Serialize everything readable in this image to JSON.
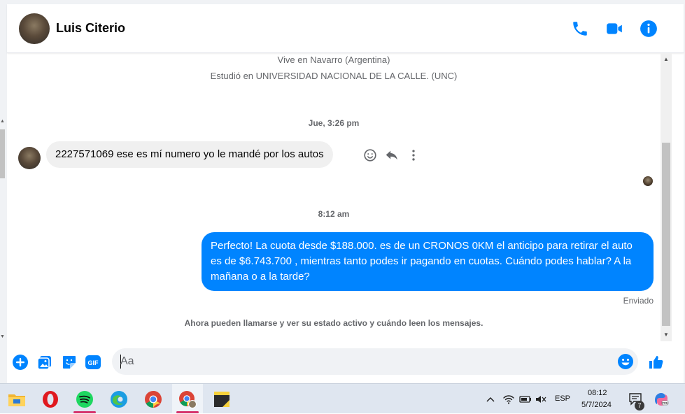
{
  "header": {
    "contact_name": "Luis Citerio",
    "icons": [
      "phone-icon",
      "video-camera-icon",
      "info-icon"
    ]
  },
  "profile": {
    "lives_in": "Vive en Navarro (Argentina)",
    "studied_at": "Estudió en UNIVERSIDAD NACIONAL DE LA CALLE. (UNC)"
  },
  "conversation": {
    "time_separator_1": "Jue, 3:26 pm",
    "incoming_message": "2227571069 ese es mí numero yo le mandé por los autos",
    "time_separator_2": "8:12 am",
    "outgoing_message": "Perfecto! La cuota desde $188.000. es de un CRONOS 0KM el anticipo para retirar el auto es de $6.743.700 , mientras tanto podes ir pagando en cuotas. Cuándo podes hablar? A la mañana o a la tarde?",
    "sent_status": "Enviado",
    "notice": "Ahora pueden llamarse y ver su estado activo y cuándo leen los mensajes."
  },
  "composer": {
    "placeholder": "Aa",
    "icons": [
      "plus-icon",
      "photo-icon",
      "sticker-icon",
      "gif-icon",
      "emoji-icon",
      "like-icon"
    ],
    "gif_label": "GIF"
  },
  "taskbar": {
    "apps": [
      "file-explorer-icon",
      "opera-icon",
      "spotify-icon",
      "edge-icon",
      "chrome-icon",
      "chrome-profile-icon",
      "sticky-notes-icon"
    ],
    "language": "ESP",
    "time": "08:12",
    "date": "5/7/2024",
    "notification_count": "7"
  },
  "colors": {
    "accent": "#0084ff",
    "incoming_bubble": "#f0f0f0",
    "secondary_text": "#65676b"
  }
}
